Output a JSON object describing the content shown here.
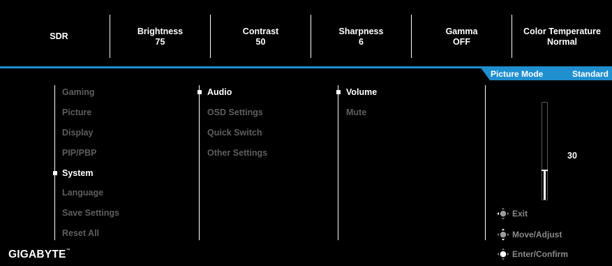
{
  "top_bar": {
    "mode": "SDR",
    "items": [
      {
        "label": "Brightness",
        "value": "75"
      },
      {
        "label": "Contrast",
        "value": "50"
      },
      {
        "label": "Sharpness",
        "value": "6"
      },
      {
        "label": "Gamma",
        "value": "OFF"
      },
      {
        "label": "Color Temperature",
        "value": "Normal"
      }
    ]
  },
  "picture_mode": {
    "label": "Picture Mode",
    "value": "Standard"
  },
  "main_menu": {
    "items": [
      "Gaming",
      "Picture",
      "Display",
      "PIP/PBP",
      "System",
      "Language",
      "Save Settings",
      "Reset All"
    ],
    "selected": "System"
  },
  "submenu": {
    "items": [
      "Audio",
      "OSD Settings",
      "Quick Switch",
      "Other Settings"
    ],
    "selected": "Audio"
  },
  "audio_menu": {
    "items": [
      "Volume",
      "Mute"
    ],
    "selected": "Volume"
  },
  "volume": {
    "value": "30",
    "level": 0.3
  },
  "help": {
    "exit_label": "Exit",
    "move_label": "Move/Adjust",
    "enter_label": "Enter/Confirm",
    "exit_icon": "joystick-left-icon",
    "move_icon": "joystick-updown-icon",
    "enter_icon": "joystick-press-icon"
  },
  "brand": {
    "name": "GIGABYTE",
    "tm": "™"
  },
  "colors": {
    "accent": "#1f8fd0",
    "active_text": "#ffffff",
    "inactive_text": "#5e5e5e",
    "background": "#000000"
  }
}
